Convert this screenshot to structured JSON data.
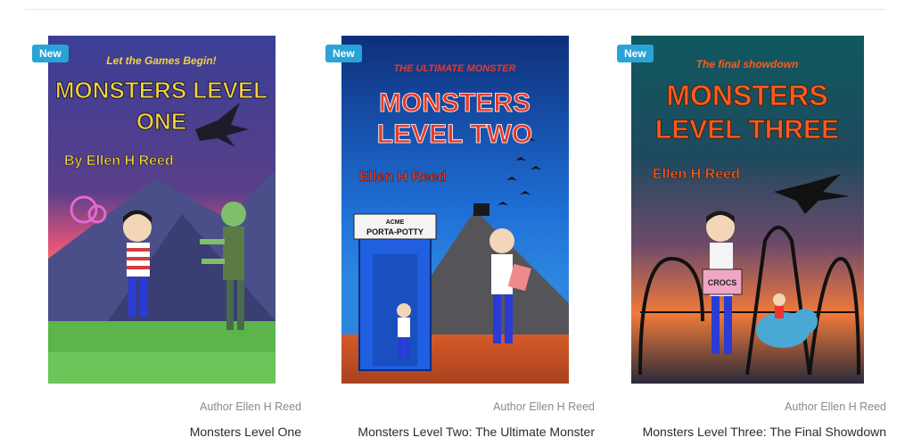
{
  "books": [
    {
      "badge": "New",
      "cover": {
        "tagline": "Let the Games Begin!",
        "title_line1": "MONSTERS LEVEL",
        "title_line2": "ONE",
        "author": "By Ellen H Reed"
      },
      "author_label": "Author Ellen H Reed",
      "title": "Monsters Level One"
    },
    {
      "badge": "New",
      "cover": {
        "tagline": "THE ULTIMATE MONSTER",
        "title_line1": "MONSTERS",
        "title_line2": "LEVEL TWO",
        "author": "Ellen H Reed",
        "sign_line1": "ACME",
        "sign_line2": "PORTA-POTTY"
      },
      "author_label": "Author Ellen H Reed",
      "title": "Monsters Level Two: The Ultimate Monster"
    },
    {
      "badge": "New",
      "cover": {
        "tagline": "The final showdown",
        "title_line1": "MONSTERS",
        "title_line2": "LEVEL THREE",
        "author": "Ellen H Reed",
        "box_label": "CROCS"
      },
      "author_label": "Author Ellen H Reed",
      "title": "Monsters Level Three: The Final Showdown"
    }
  ],
  "colors": {
    "badge": "#2aa3d6",
    "cover1_title": "#f6d23a",
    "cover2_title": "#e53b2a",
    "cover3_title": "#ff5a1f"
  }
}
